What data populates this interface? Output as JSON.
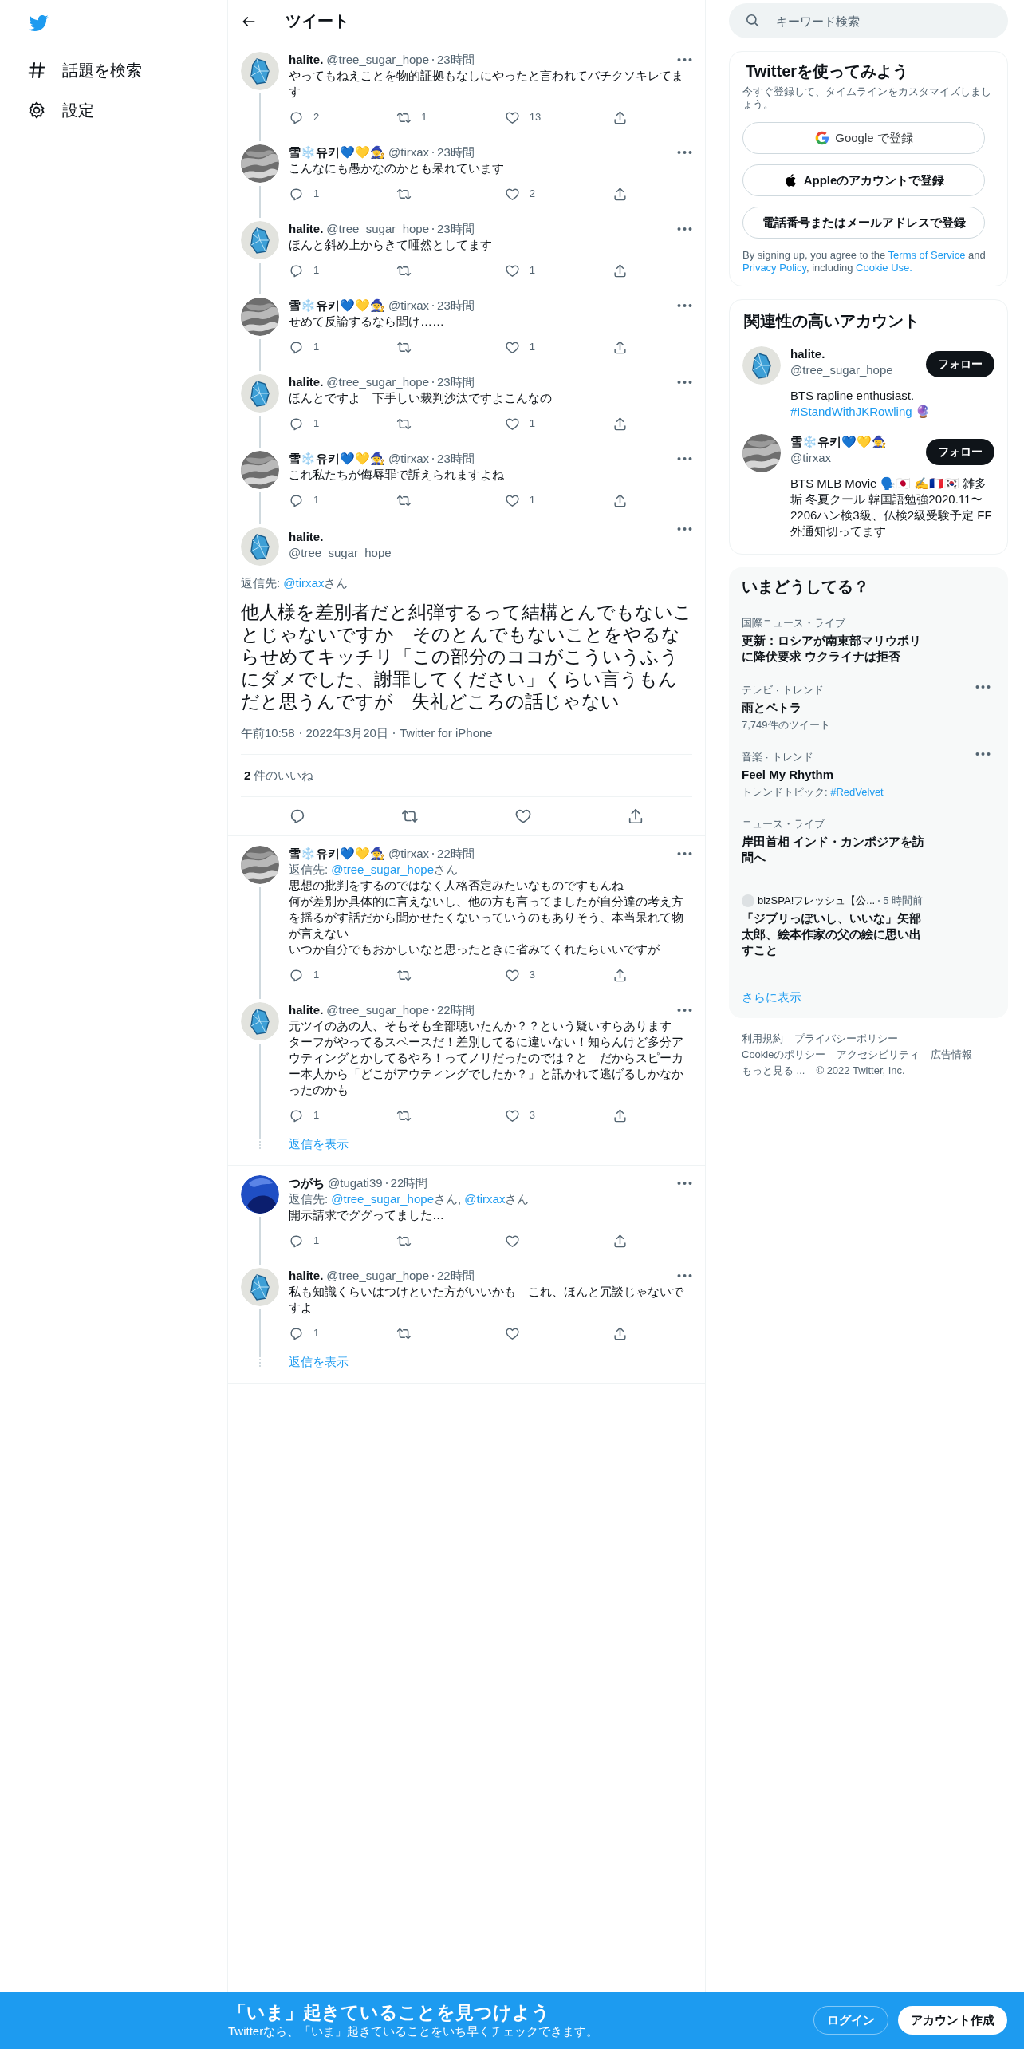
{
  "nav": {
    "items": [
      {
        "kind": "explore",
        "label": "話題を検索"
      },
      {
        "kind": "settings",
        "label": "設定"
      }
    ]
  },
  "header": {
    "title": "ツイート"
  },
  "ancestors": [
    {
      "avatar": {
        "kind": "crystal"
      },
      "name": "halite.",
      "handle": "@tree_sugar_hope",
      "time": "23時間",
      "text": [
        "やってもねえことを物的証拠もなしにやったと言われてバチクソキレてます"
      ],
      "replies": "2",
      "retweets": "1",
      "likes": "13"
    },
    {
      "avatar": {
        "kind": "gray"
      },
      "name": "雪❄️유키💙💛🧙‍♀️",
      "handle": "@tirxax",
      "time": "23時間",
      "text": [
        "こんなにも愚かなのかとも呆れています"
      ],
      "replies": "1",
      "likes": "2"
    },
    {
      "avatar": {
        "kind": "crystal"
      },
      "name": "halite.",
      "handle": "@tree_sugar_hope",
      "time": "23時間",
      "text": [
        "ほんと斜め上からきて唖然としてます"
      ],
      "replies": "1",
      "likes": "1"
    },
    {
      "avatar": {
        "kind": "gray"
      },
      "name": "雪❄️유키💙💛🧙‍♀️",
      "handle": "@tirxax",
      "time": "23時間",
      "text": [
        "せめて反論するなら聞け……"
      ],
      "replies": "1",
      "likes": "1"
    },
    {
      "avatar": {
        "kind": "crystal"
      },
      "name": "halite.",
      "handle": "@tree_sugar_hope",
      "time": "23時間",
      "text": [
        "ほんとですよ　下手しい裁判沙汰ですよこんなの"
      ],
      "replies": "1",
      "likes": "1"
    },
    {
      "avatar": {
        "kind": "gray"
      },
      "name": "雪❄️유키💙💛🧙‍♀️",
      "handle": "@tirxax",
      "time": "23時間",
      "text": [
        "これ私たちが侮辱罪で訴えられますよね"
      ],
      "replies": "1",
      "likes": "1"
    }
  ],
  "focus": {
    "avatar": {
      "kind": "crystal"
    },
    "name": "halite.",
    "handle": "@tree_sugar_hope",
    "reply_to": [
      {
        "text": "返信先: ",
        "link": false
      },
      {
        "text": "@tirxax",
        "link": true
      },
      {
        "text": "さん",
        "link": false
      }
    ],
    "text": "他人様を差別者だと糾弾するって結構とんでもないことじゃないですか　そのとんでもないことをやるならせめてキッチリ「この部分のココがこういうふうにダメでした、謝罪してください」くらい言うもんだと思うんですが　失礼どころの話じゃない",
    "meta": [
      "午前10:58",
      "2022年3月20日",
      "Twitter for iPhone"
    ],
    "likes_count": "2",
    "likes_label": "件のいいね"
  },
  "reply_threads": [
    {
      "more": "返信を表示",
      "tweets": [
        {
          "avatar": {
            "kind": "gray"
          },
          "name": "雪❄️유키💙💛🧙‍♀️",
          "handle": "@tirxax",
          "time": "22時間",
          "reply_to": [
            {
              "text": "返信先: ",
              "link": false
            },
            {
              "text": "@tree_sugar_hope",
              "link": true
            },
            {
              "text": "さん",
              "link": false
            }
          ],
          "text": [
            "思想の批判をするのではなく人格否定みたいなものですもんね",
            "何が差別か具体的に言えないし、他の方も言ってましたが自分達の考え方を揺るがす話だから聞かせたくないっていうのもありそう、本当呆れて物が言えない",
            "いつか自分でもおかしいなと思ったときに省みてくれたらいいですが"
          ],
          "replies": "1",
          "likes": "3"
        },
        {
          "avatar": {
            "kind": "crystal"
          },
          "name": "halite.",
          "handle": "@tree_sugar_hope",
          "time": "22時間",
          "text": [
            "元ツイのあの人、そもそも全部聴いたんか？？という疑いすらあります",
            "ターフがやってるスペースだ！差別してるに違いない！知らんけど多分アウティングとかしてるやろ！ってノリだったのでは？と　だからスピーカー本人から「どこがアウティングでしたか？」と訊かれて逃げるしかなかったのかも"
          ],
          "replies": "1",
          "likes": "3"
        }
      ]
    },
    {
      "more": "返信を表示",
      "tweets": [
        {
          "avatar": {
            "kind": "blue"
          },
          "name": "つがち",
          "handle": "@tugati39",
          "time": "22時間",
          "reply_to": [
            {
              "text": "返信先: ",
              "link": false
            },
            {
              "text": "@tree_sugar_hope",
              "link": true
            },
            {
              "text": "さん, ",
              "link": false
            },
            {
              "text": "@tirxax",
              "link": true
            },
            {
              "text": "さん",
              "link": false
            }
          ],
          "text": [
            "開示請求でググってました…"
          ],
          "replies": "1"
        },
        {
          "avatar": {
            "kind": "crystal"
          },
          "name": "halite.",
          "handle": "@tree_sugar_hope",
          "time": "22時間",
          "text": [
            "私も知識くらいはつけといた方がいいかも　これ、ほんと冗談じゃないですよ"
          ],
          "replies": "1"
        }
      ]
    }
  ],
  "search": {
    "placeholder": "キーワード検索"
  },
  "signup": {
    "title": "Twitterを使ってみよう",
    "subtitle": "今すぐ登録して、タイムラインをカスタマイズしましょう。",
    "buttons": [
      {
        "kind": "google",
        "label": "Google で登録"
      },
      {
        "kind": "apple",
        "label": "Appleのアカウントで登録"
      },
      {
        "kind": "phone",
        "label": "電話番号またはメールアドレスで登録"
      }
    ],
    "legal": [
      {
        "text": "By signing up, you agree to the ",
        "link": false
      },
      {
        "text": "Terms of Service",
        "link": true
      },
      {
        "text": " and ",
        "link": false
      },
      {
        "text": "Privacy Policy",
        "link": true
      },
      {
        "text": ", including ",
        "link": false
      },
      {
        "text": "Cookie Use.",
        "link": true
      }
    ]
  },
  "who_to_follow": {
    "title": "関連性の高いアカウント",
    "accounts": [
      {
        "avatar": {
          "kind": "crystal"
        },
        "name": "halite.",
        "handle": "@tree_sugar_hope",
        "button": "フォロー",
        "bio": [
          {
            "text": "BTS rapline enthusiast. ",
            "link": false
          },
          {
            "text": "#IStandWithJKRowling",
            "link": true
          },
          {
            "text": " 🔮",
            "link": false
          }
        ]
      },
      {
        "avatar": {
          "kind": "gray"
        },
        "name": "雪❄️유키💙💛🧙‍♀️",
        "handle": "@tirxax",
        "button": "フォロー",
        "bio": [
          {
            "text": "BTS MLB Movie 🗣️🇯🇵 ✍️🇫🇷🇰🇷 雑多垢 冬夏クール 韓国語勉強2020.11〜2206ハン検3級、仏検2級受験予定 FF外通知切ってます",
            "link": false
          }
        ]
      }
    ]
  },
  "trends": {
    "title": "いまどうしてる？",
    "items": [
      {
        "kind": "trend",
        "category": "国際ニュース・ライブ",
        "title": "更新：ロシアが南東部マリウポリに降伏要求 ウクライナは拒否",
        "menu": false
      },
      {
        "kind": "trend",
        "category": "テレビ · トレンド",
        "title": "雨とペトラ",
        "meta": [
          {
            "text": "7,749件のツイート",
            "link": false
          }
        ],
        "menu": true
      },
      {
        "kind": "trend",
        "category": "音楽 · トレンド",
        "title": "Feel My Rhythm",
        "meta": [
          {
            "text": "トレンドトピック: ",
            "link": false
          },
          {
            "text": "#RedVelvet",
            "link": true
          }
        ],
        "menu": true
      },
      {
        "kind": "trend",
        "category": "ニュース・ライブ",
        "title": "岸田首相 インド・カンボジアを訪問へ",
        "menu": false
      },
      {
        "kind": "news",
        "source": "bizSPA!フレッシュ【公...",
        "time": "5 時間前",
        "title": "「ジブリっぽいし、いいな」矢部太郎、絵本作家の父の絵に思い出すこと",
        "menu": false
      }
    ],
    "show_more": "さらに表示"
  },
  "footer": {
    "rows": [
      [
        "利用規約",
        "プライバシーポリシー"
      ],
      [
        "Cookieのポリシー",
        "アクセシビリティ",
        "広告情報"
      ],
      [
        "もっと見る ...",
        "© 2022 Twitter, Inc."
      ]
    ]
  },
  "banner": {
    "title": "「いま」起きていることを見つけよう",
    "subtitle": "Twitterなら、「いま」起きていることをいち早くチェックできます。",
    "buttons": [
      {
        "kind": "outline",
        "label": "ログイン"
      },
      {
        "kind": "filled",
        "label": "アカウント作成"
      }
    ]
  }
}
